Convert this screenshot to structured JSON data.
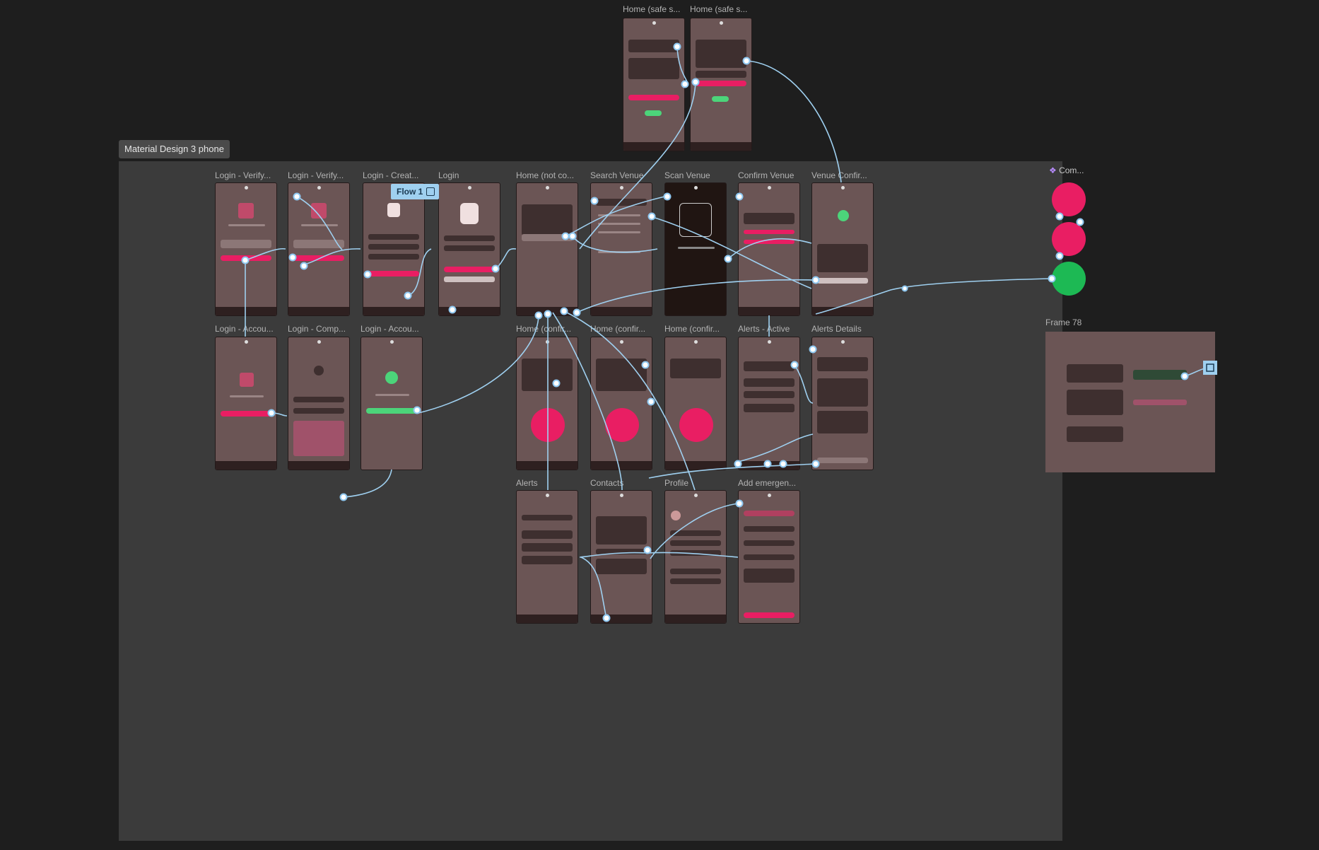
{
  "section": {
    "label": "Material Design 3 phone"
  },
  "flow": {
    "label": "Flow 1"
  },
  "component": {
    "label": "Com..."
  },
  "frame78": {
    "label": "Frame 78"
  },
  "top_frames": [
    {
      "label": "Home (safe s..."
    },
    {
      "label": "Home (safe s..."
    }
  ],
  "row1": [
    {
      "label": "Login - Verify..."
    },
    {
      "label": "Login - Verify..."
    },
    {
      "label": "Login - Creat..."
    },
    {
      "label": "Login"
    },
    {
      "label": "Home (not co..."
    },
    {
      "label": "Search Venue"
    },
    {
      "label": "Scan Venue"
    },
    {
      "label": "Confirm Venue"
    },
    {
      "label": "Venue Confir..."
    }
  ],
  "row2": [
    {
      "label": "Login - Accou..."
    },
    {
      "label": "Login - Comp..."
    },
    {
      "label": "Login - Accou..."
    },
    {
      "label": "Home (confir..."
    },
    {
      "label": "Home (confir..."
    },
    {
      "label": "Home (confir..."
    },
    {
      "label": "Alerts - Active"
    },
    {
      "label": "Alerts Details"
    }
  ],
  "row3": [
    {
      "label": "Alerts"
    },
    {
      "label": "Contacts"
    },
    {
      "label": "Profile"
    },
    {
      "label": "Add emergen..."
    }
  ],
  "colors": {
    "accent": "#e91e63",
    "success": "#1db954",
    "link": "#9fd0f0",
    "screen": "#6b5555"
  }
}
